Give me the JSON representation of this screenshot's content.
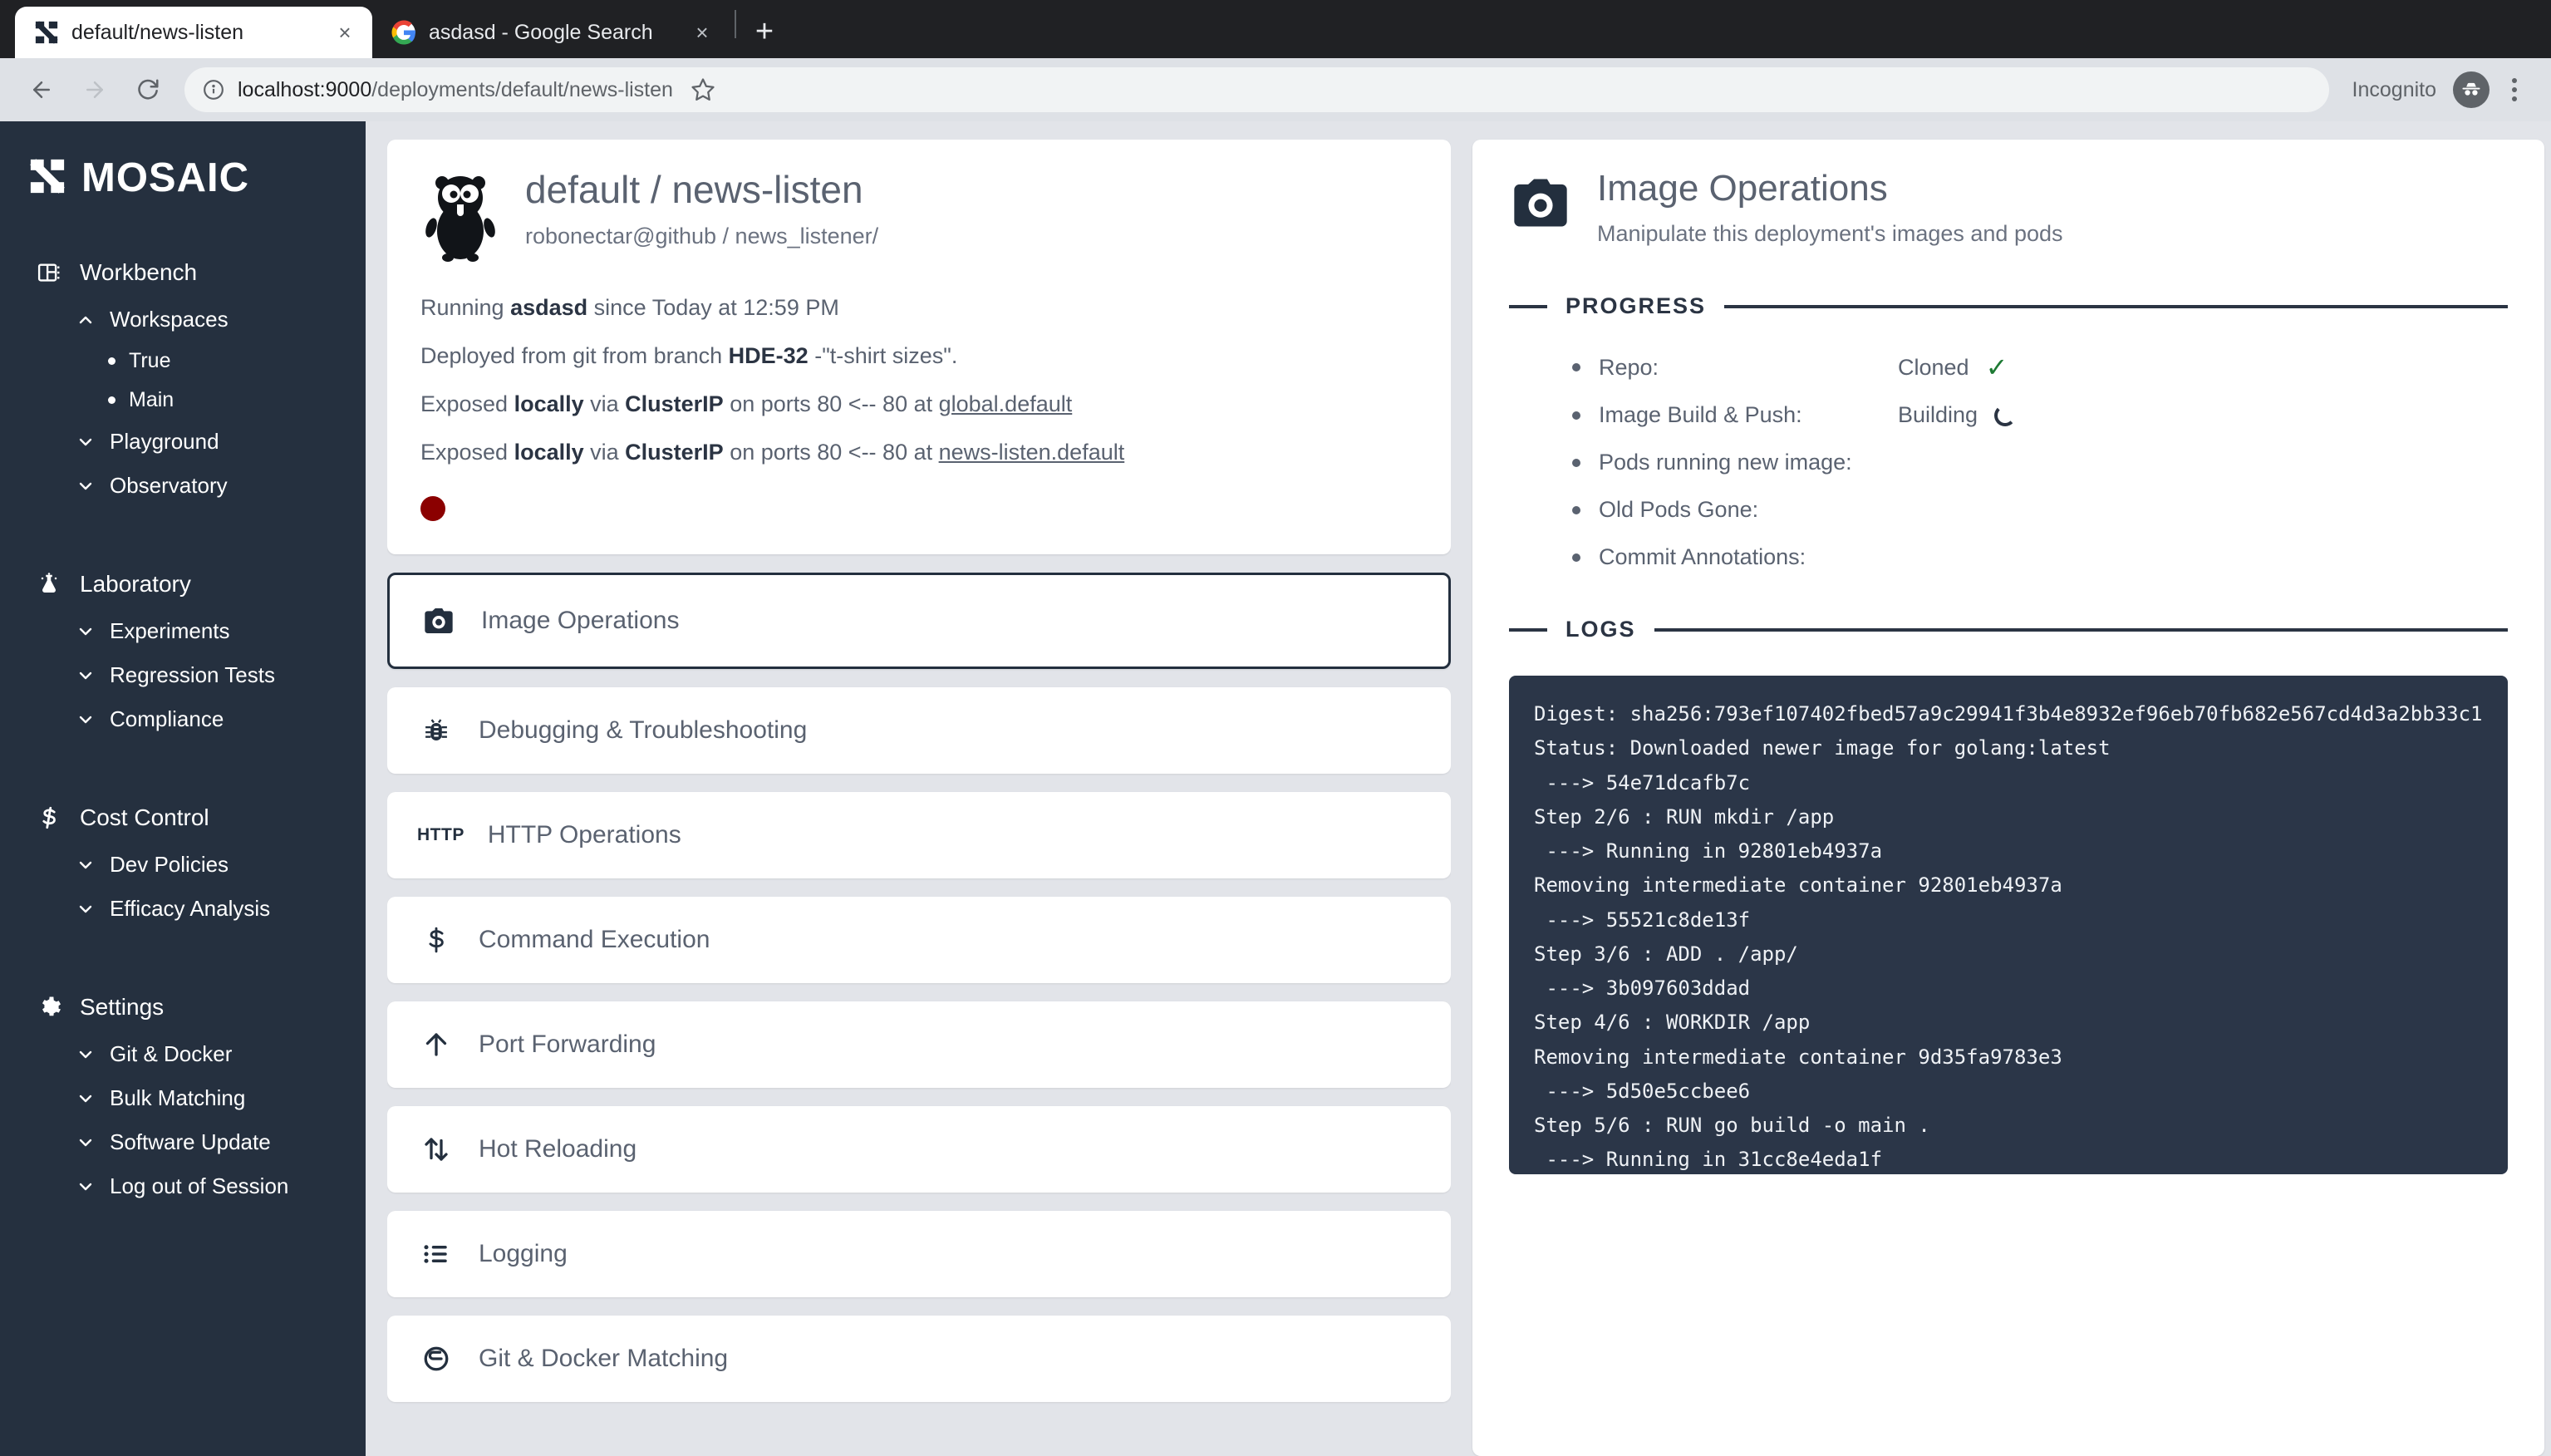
{
  "browser": {
    "tabs": [
      {
        "title": "default/news-listen",
        "favicon": "mosaic-logo-icon",
        "active": true,
        "close_label": "×"
      },
      {
        "title": "asdasd - Google Search",
        "favicon": "google-icon",
        "active": false,
        "close_label": "×"
      }
    ],
    "new_tab_label": "+",
    "back_label": "←",
    "forward_label": "→",
    "reload_label": "⟳",
    "url_host": "localhost:9000",
    "url_path": "/deployments/default/news-listen",
    "incognito_label": "Incognito"
  },
  "sidebar": {
    "brand": "MOSAIC",
    "groups": [
      {
        "name": "Workbench",
        "icon": "workbench-icon",
        "items": [
          {
            "label": "Workspaces",
            "chevron": "up",
            "children": [
              {
                "label": "True"
              },
              {
                "label": "Main"
              }
            ]
          },
          {
            "label": "Playground",
            "chevron": "down",
            "children": []
          },
          {
            "label": "Observatory",
            "chevron": "down",
            "children": []
          }
        ]
      },
      {
        "name": "Laboratory",
        "icon": "flask-icon",
        "items": [
          {
            "label": "Experiments",
            "chevron": "down",
            "children": []
          },
          {
            "label": "Regression Tests",
            "chevron": "down",
            "children": []
          },
          {
            "label": "Compliance",
            "chevron": "down",
            "children": []
          }
        ]
      },
      {
        "name": "Cost Control",
        "icon": "dollar-icon",
        "items": [
          {
            "label": "Dev Policies",
            "chevron": "down",
            "children": []
          },
          {
            "label": "Efficacy Analysis",
            "chevron": "down",
            "children": []
          }
        ]
      },
      {
        "name": "Settings",
        "icon": "gear-icon",
        "items": [
          {
            "label": "Git & Docker",
            "chevron": "down",
            "children": []
          },
          {
            "label": "Bulk Matching",
            "chevron": "down",
            "children": []
          },
          {
            "label": "Software Update",
            "chevron": "down",
            "children": []
          },
          {
            "label": "Log out of Session",
            "chevron": "down",
            "children": []
          }
        ]
      }
    ]
  },
  "deployment": {
    "title": "default / news-listen",
    "repo": "robonectar@github / news_listener/",
    "running_prefix": "Running ",
    "running_name": "asdasd",
    "running_suffix": " since Today at 12:59 PM",
    "deployed_prefix": "Deployed from git from branch ",
    "deployed_branch": "HDE-32",
    "deployed_suffix": " -\"t-shirt sizes\".",
    "exposures": [
      {
        "p1": "Exposed ",
        "b1": "locally",
        "p2": " via ",
        "b2": "ClusterIP",
        "p3": " on ports 80 <-- 80 at ",
        "link": "global.default"
      },
      {
        "p1": "Exposed ",
        "b1": "locally",
        "p2": " via ",
        "b2": "ClusterIP",
        "p3": " on ports 80 <-- 80 at ",
        "link": "news-listen.default"
      }
    ],
    "status_color": "#8b0000"
  },
  "operations": [
    {
      "label": "Image Operations",
      "icon": "camera-icon",
      "selected": true
    },
    {
      "label": "Debugging & Troubleshooting",
      "icon": "bug-icon",
      "selected": false
    },
    {
      "label": "HTTP Operations",
      "icon": "http-icon",
      "selected": false
    },
    {
      "label": "Command Execution",
      "icon": "dollar-prompt-icon",
      "selected": false
    },
    {
      "label": "Port Forwarding",
      "icon": "arrow-up-icon",
      "selected": false
    },
    {
      "label": "Hot Reloading",
      "icon": "arrows-updown-icon",
      "selected": false
    },
    {
      "label": "Logging",
      "icon": "list-icon",
      "selected": false
    },
    {
      "label": "Git & Docker Matching",
      "icon": "link-icon",
      "selected": false
    }
  ],
  "panel": {
    "title": "Image Operations",
    "subtitle": "Manipulate this deployment's images and pods",
    "icon": "camera-icon",
    "progress_heading": "PROGRESS",
    "logs_heading": "LOGS",
    "progress": [
      {
        "label": "Repo:",
        "value": "Cloned",
        "state": "done"
      },
      {
        "label": "Image Build & Push:",
        "value": "Building",
        "state": "loading"
      },
      {
        "label": "Pods running new image:",
        "value": "",
        "state": "pending"
      },
      {
        "label": "Old Pods Gone:",
        "value": "",
        "state": "pending"
      },
      {
        "label": "Commit Annotations:",
        "value": "",
        "state": "pending"
      }
    ],
    "log_lines": [
      "Digest: sha256:793ef107402fbed57a9c29941f3b4e8932ef96eb70fb682e567cd4d3a2bb33c1",
      "Status: Downloaded newer image for golang:latest",
      " ---> 54e71dcafb7c",
      "Step 2/6 : RUN mkdir /app",
      " ---> Running in 92801eb4937a",
      "Removing intermediate container 92801eb4937a",
      " ---> 55521c8de13f",
      "Step 3/6 : ADD . /app/",
      " ---> 3b097603ddad",
      "Step 4/6 : WORKDIR /app",
      "Removing intermediate container 9d35fa9783e3",
      " ---> 5d50e5ccbee6",
      "Step 5/6 : RUN go build -o main .",
      " ---> Running in 31cc8e4eda1f"
    ]
  }
}
